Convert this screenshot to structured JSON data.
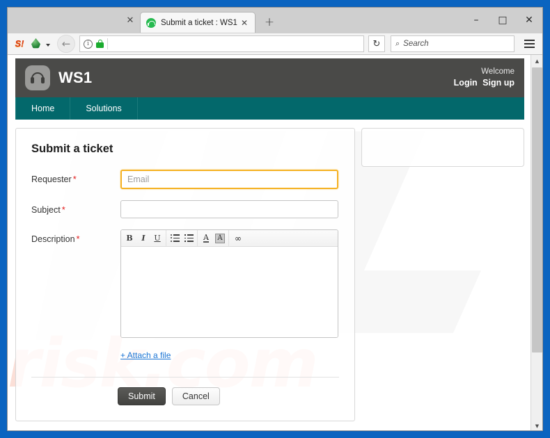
{
  "browser": {
    "tab": {
      "title": "Submit a ticket : WS1",
      "favicon": "headset-circle-icon",
      "close_label": "✕"
    },
    "extra_tab_close_label": "✕",
    "new_tab_label": "+",
    "window_controls": {
      "minimize": "–",
      "maximize": "□",
      "close": "✕"
    },
    "toolbar": {
      "extension_s_label": "S!",
      "extension_dropper_name": "green-drop-icon",
      "back_label": "←",
      "page_info_label": "i",
      "lock_name": "padlock-icon",
      "url_value": "",
      "reload_label": "↻",
      "search_glyph": "⌕",
      "search_placeholder": "Search",
      "menu_name": "hamburger-menu-icon"
    }
  },
  "site": {
    "logo_name": "headset-logo-icon",
    "title": "WS1",
    "account": {
      "welcome": "Welcome",
      "login": "Login",
      "signup": "Sign up"
    },
    "nav": [
      {
        "label": "Home"
      },
      {
        "label": "Solutions"
      }
    ]
  },
  "form": {
    "title": "Submit a ticket",
    "required_marker": "*",
    "fields": {
      "requester": {
        "label": "Requester",
        "placeholder": "Email",
        "value": "",
        "required": true,
        "focused": true
      },
      "subject": {
        "label": "Subject",
        "placeholder": "",
        "value": "",
        "required": true
      },
      "description": {
        "label": "Description",
        "value": "",
        "required": true
      }
    },
    "editor_toolbar": [
      {
        "name": "bold-icon",
        "label": "B"
      },
      {
        "name": "italic-icon",
        "label": "I"
      },
      {
        "name": "underline-icon",
        "label": "U"
      },
      {
        "name": "unordered-list-icon",
        "label": ""
      },
      {
        "name": "ordered-list-icon",
        "label": ""
      },
      {
        "name": "font-color-icon",
        "label": "A"
      },
      {
        "name": "highlight-color-icon",
        "label": "A"
      },
      {
        "name": "insert-link-icon",
        "label": "∞"
      }
    ],
    "attach_label": "+ Attach a file",
    "submit_label": "Submit",
    "cancel_label": "Cancel"
  },
  "side_panel": {
    "content": ""
  },
  "watermark": {
    "text": "risk.com"
  },
  "colors": {
    "desktop": "#0b64c0",
    "header_bar": "#4a4a48",
    "nav_bar": "#03686b",
    "focus_outline": "#f5b121",
    "required_star": "#e21b1b",
    "link": "#1a74d4",
    "watermark": "#fbdfd7"
  },
  "scrollbar": {
    "up_label": "▲",
    "down_label": "▼"
  }
}
